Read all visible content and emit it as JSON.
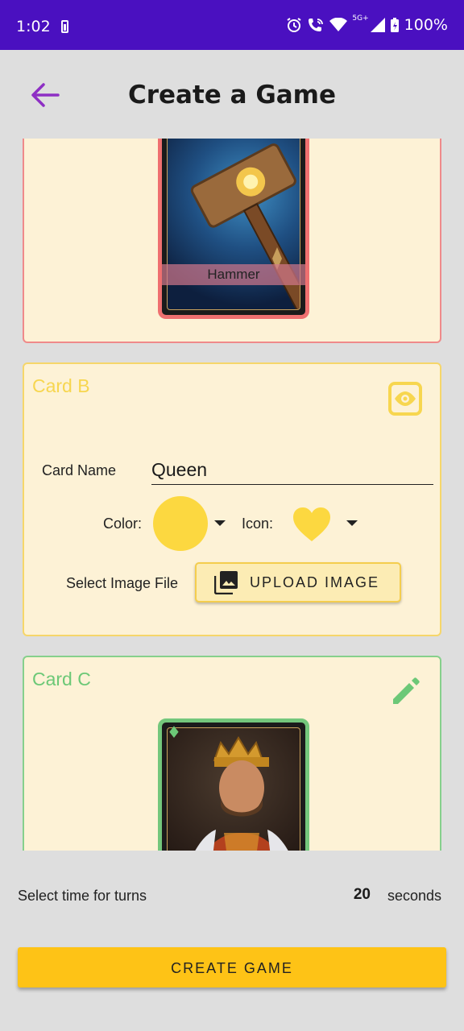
{
  "status_bar": {
    "time": "1:02",
    "network": "5G+",
    "battery": "100%",
    "icons": [
      "battery-icon",
      "alarm-icon",
      "wifi-call-icon",
      "wifi-icon",
      "signal-icon",
      "battery-icon"
    ]
  },
  "header": {
    "title": "Create a Game",
    "back_icon": "arrow-left-icon",
    "accent_color": "#8e2fc4"
  },
  "cards": [
    {
      "id": "a",
      "border_color": "#ef8a8a",
      "suit": "♣",
      "suit_icon": "club-icon",
      "preview_label": "Hammer"
    },
    {
      "id": "b",
      "title": "Card B",
      "accent_color": "#f7d64f",
      "action_icon": "eye-icon",
      "name_label": "Card Name",
      "name_value": "Queen",
      "color_label": "Color:",
      "color_value": "#fcd840",
      "icon_label": "Icon:",
      "icon_value": "heart-icon",
      "image_label": "Select Image File",
      "upload_label": "UPLOAD IMAGE"
    },
    {
      "id": "c",
      "title": "Card C",
      "accent_color": "#6cc877",
      "action_icon": "pencil-icon",
      "suit": "♦",
      "suit_icon": "diamond-icon"
    }
  ],
  "turn_time": {
    "label": "Select time for turns",
    "value": "20",
    "unit": "seconds"
  },
  "create_button": {
    "label": "CREATE GAME",
    "color": "#fec316"
  }
}
